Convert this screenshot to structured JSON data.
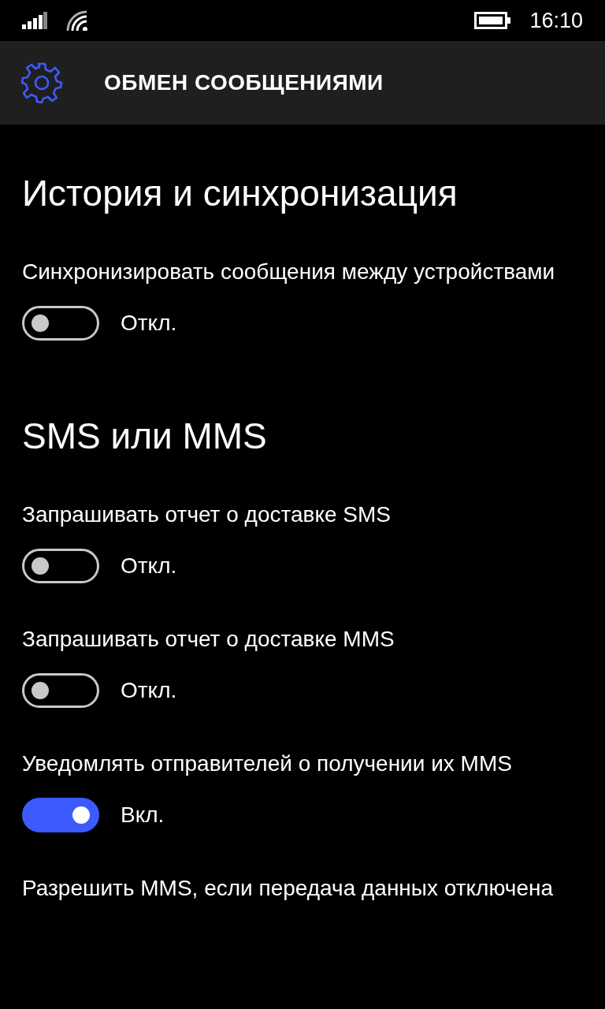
{
  "status_bar": {
    "time": "16:10"
  },
  "header": {
    "title": "ОБМЕН СООБЩЕНИЯМИ"
  },
  "sections": [
    {
      "title": "История и синхронизация",
      "settings": [
        {
          "label": "Синхронизировать сообщения между устройствами",
          "on": false,
          "state_text": "Откл."
        }
      ]
    },
    {
      "title": "SMS или MMS",
      "settings": [
        {
          "label": "Запрашивать отчет о доставке SMS",
          "on": false,
          "state_text": "Откл."
        },
        {
          "label": "Запрашивать отчет о доставке MMS",
          "on": false,
          "state_text": "Откл."
        },
        {
          "label": "Уведомлять отправителей о получении их MMS",
          "on": true,
          "state_text": "Вкл."
        },
        {
          "label": "Разрешить MMS, если передача данных отключена"
        }
      ]
    }
  ]
}
